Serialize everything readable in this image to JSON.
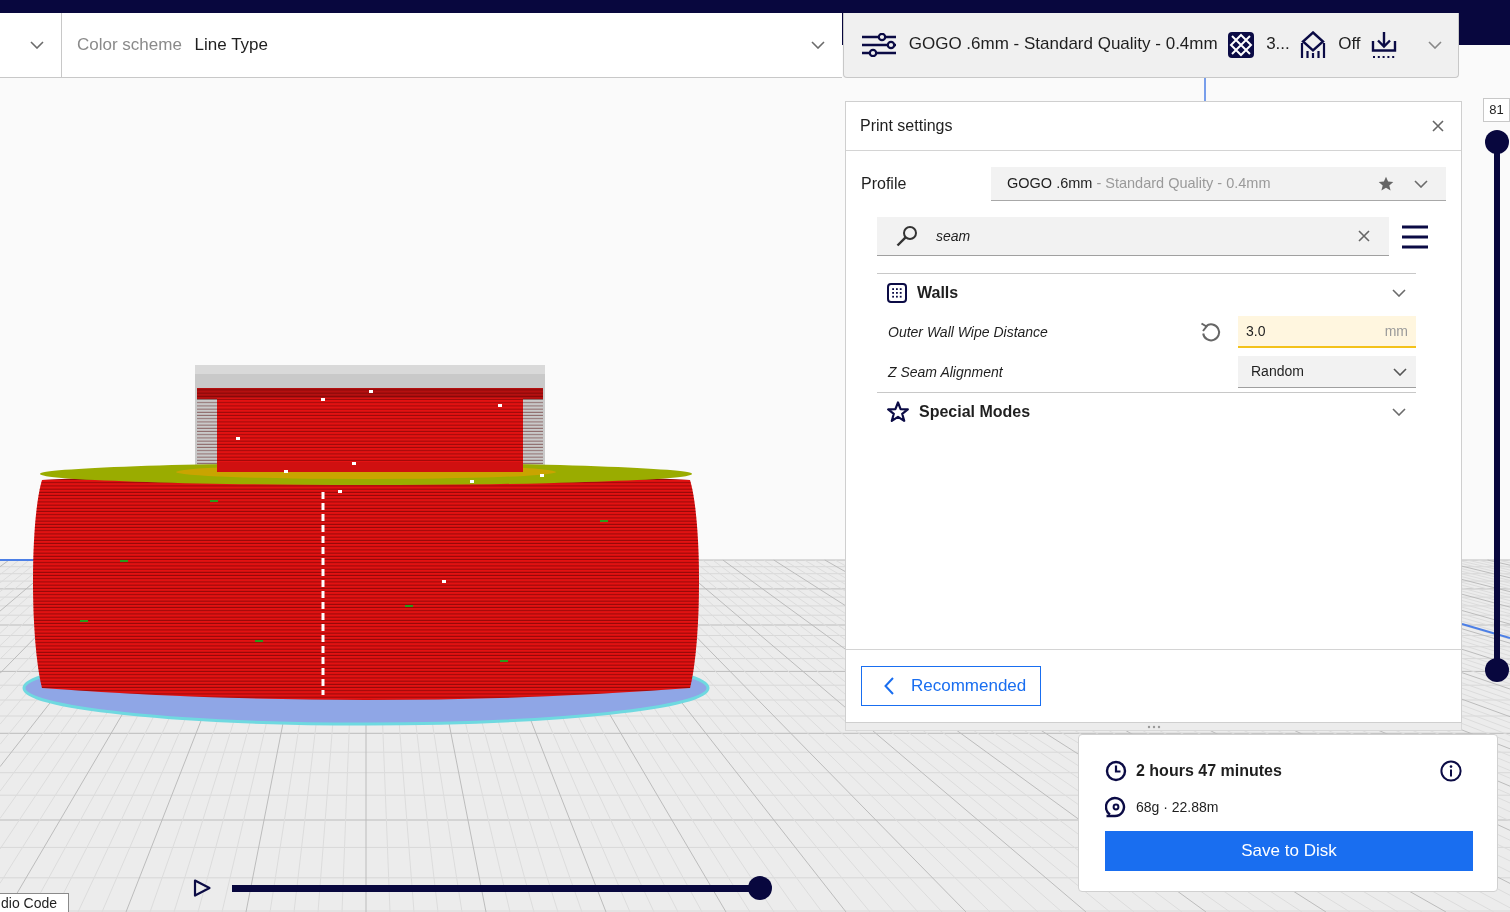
{
  "toolbar": {
    "color_scheme": {
      "label": "Color scheme",
      "value": "Line Type"
    },
    "print_setup": {
      "profile": "GOGO .6mm - Standard Quality - 0.4mm",
      "infill": "3...",
      "support": "Off"
    }
  },
  "print_settings": {
    "title": "Print settings",
    "profile": {
      "label": "Profile",
      "name": "GOGO .6mm",
      "detail": "- Standard Quality - 0.4mm"
    },
    "search": {
      "value": "seam"
    },
    "categories": [
      {
        "title": "Walls",
        "settings": [
          {
            "kind": "number",
            "label": "Outer Wall Wipe Distance",
            "value": "3.0",
            "unit": "mm",
            "modified": true,
            "warning": true
          },
          {
            "kind": "dropdown",
            "label": "Z Seam Alignment",
            "value": "Random",
            "modified": false,
            "warning": false
          }
        ]
      },
      {
        "title": "Special Modes"
      }
    ],
    "mode_button": "Recommended"
  },
  "layer_slider": {
    "value": "81",
    "level": 1
  },
  "output": {
    "print_time": "2 hours 47 minutes",
    "material": "68g · 22.88m",
    "save_button": "Save to Disk"
  },
  "simulation": {
    "level": 1
  },
  "tooltip": "dio Code"
}
